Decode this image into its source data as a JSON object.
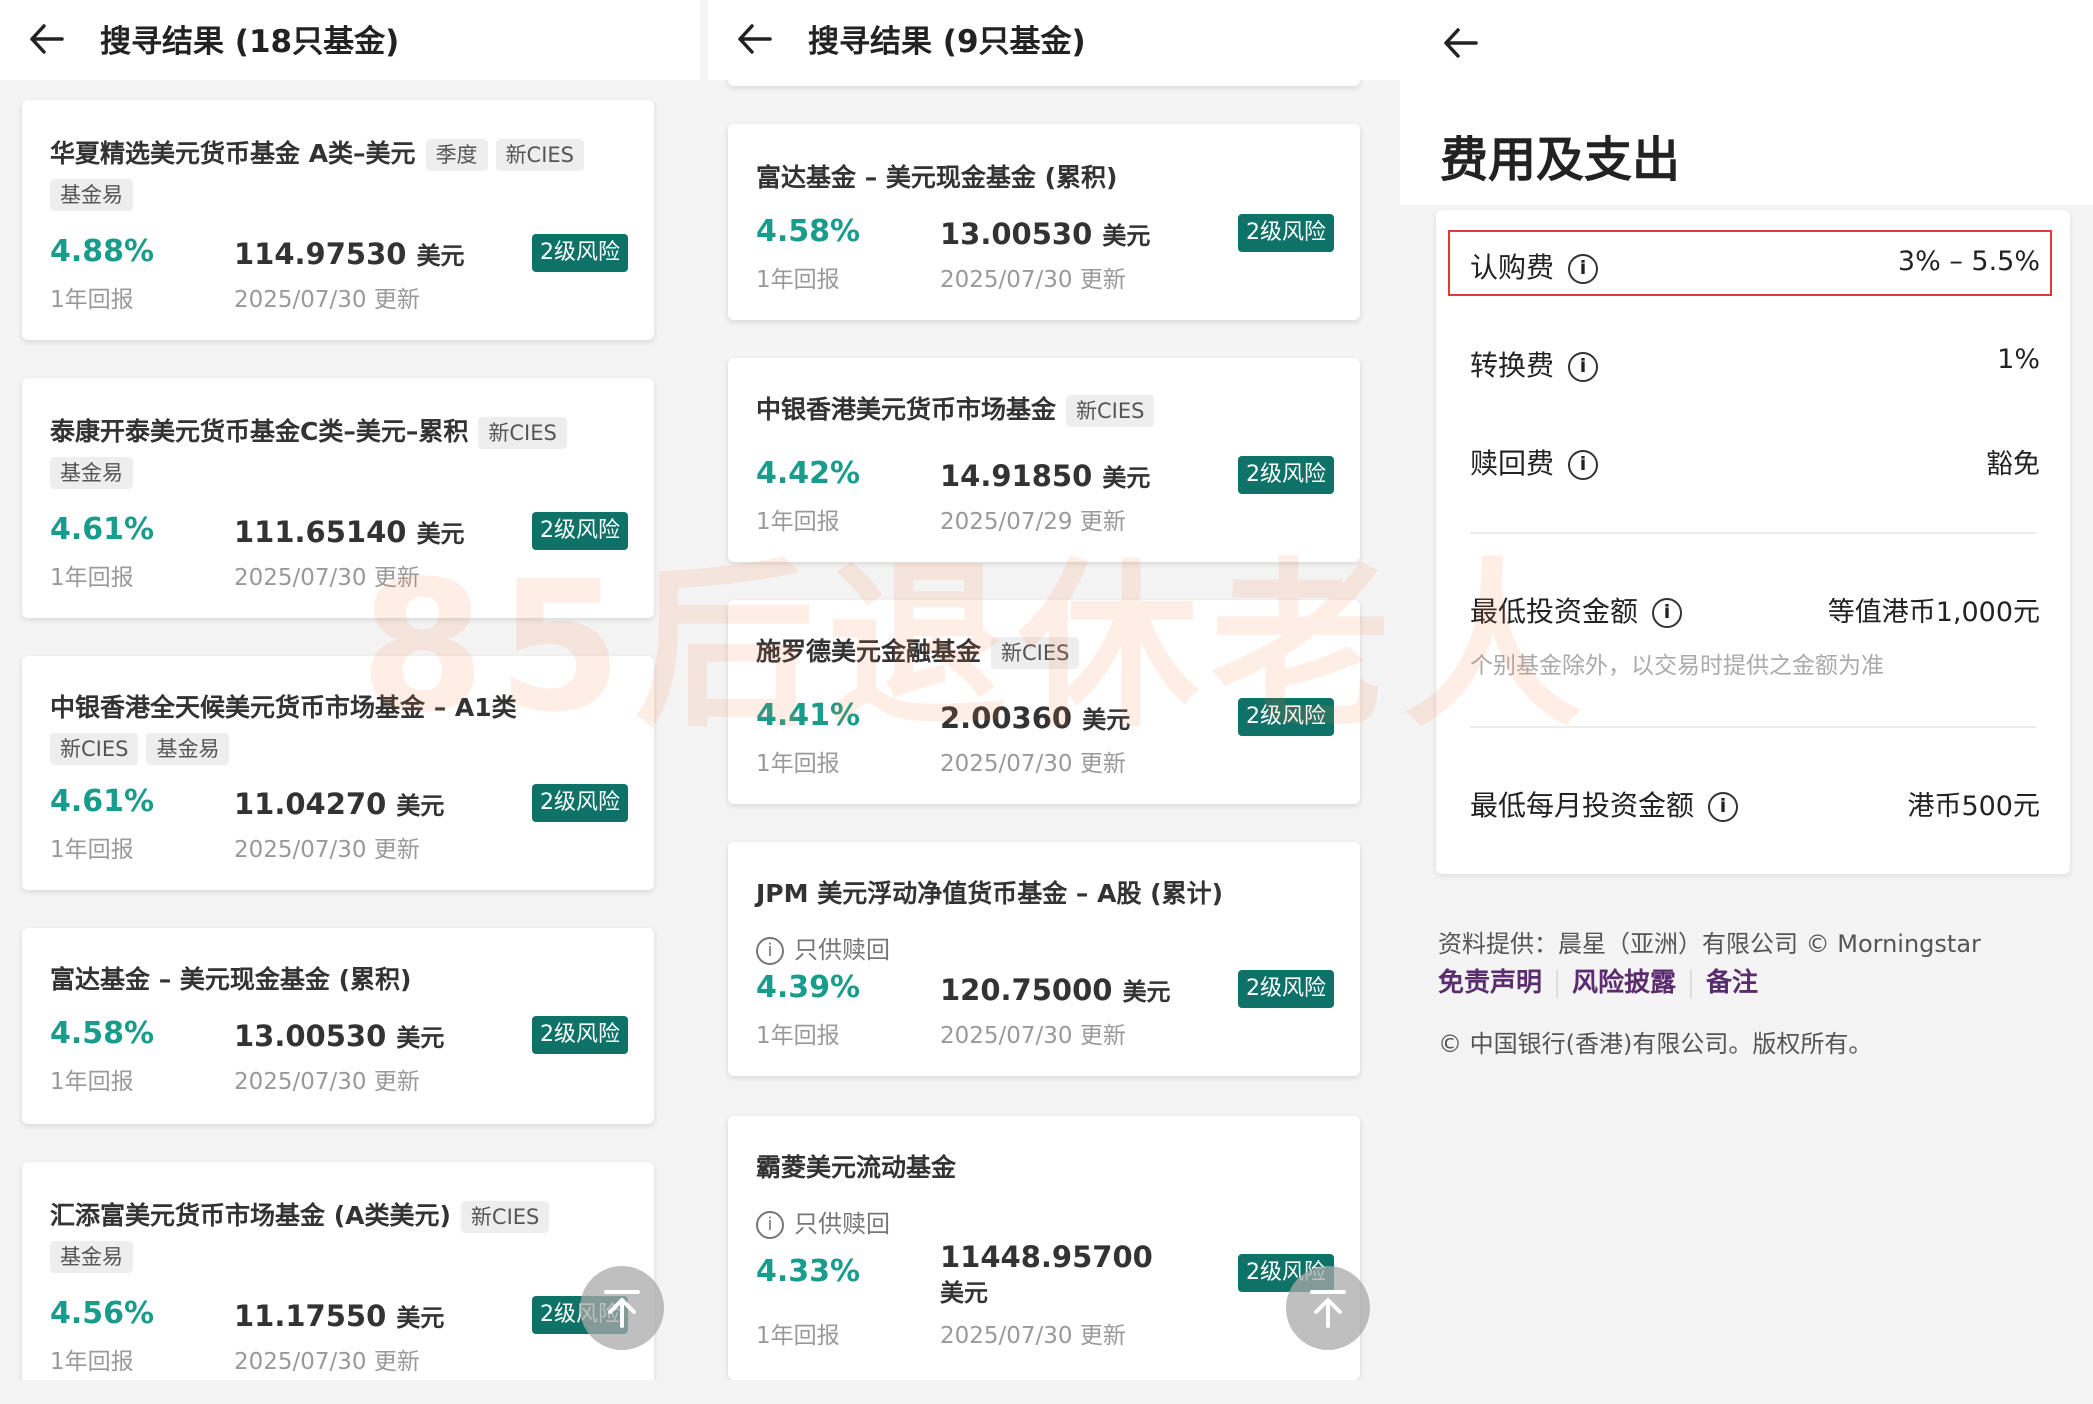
{
  "panel1": {
    "title": "搜寻结果 (18只基金)",
    "cards": [
      {
        "name": "华夏精选美元货币基金 A类–美元",
        "tags_inline": [
          "季度",
          "新CIES"
        ],
        "tags_next": [
          "基金易"
        ],
        "return": "4.88%",
        "return_label": "1年回报",
        "nav": "114.97530",
        "unit": "美元",
        "date": "2025/07/30 更新",
        "risk": "2级风险"
      },
      {
        "name": "泰康开泰美元货币基金C类–美元–累积",
        "tags_inline": [
          "新CIES"
        ],
        "tags_next": [
          "基金易"
        ],
        "return": "4.61%",
        "return_label": "1年回报",
        "nav": "111.65140",
        "unit": "美元",
        "date": "2025/07/30 更新",
        "risk": "2级风险"
      },
      {
        "name": "中银香港全天候美元货币市场基金 – A1类",
        "tags_inline": [],
        "tags_next": [
          "新CIES",
          "基金易"
        ],
        "return": "4.61%",
        "return_label": "1年回报",
        "nav": "11.04270",
        "unit": "美元",
        "date": "2025/07/30 更新",
        "risk": "2级风险"
      },
      {
        "name": "富达基金 – 美元现金基金 (累积)",
        "tags_inline": [],
        "tags_next": [],
        "return": "4.58%",
        "return_label": "1年回报",
        "nav": "13.00530",
        "unit": "美元",
        "date": "2025/07/30 更新",
        "risk": "2级风险"
      },
      {
        "name": "汇添富美元货币市场基金 (A类美元)",
        "tags_inline": [
          "新CIES"
        ],
        "tags_next": [
          "基金易"
        ],
        "return": "4.56%",
        "return_label": "1年回报",
        "nav": "11.17550",
        "unit": "美元",
        "date": "2025/07/30 更新",
        "risk": "2级风险"
      }
    ]
  },
  "panel2": {
    "title": "搜寻结果 (9只基金)",
    "cards": [
      {
        "name": "富达基金 – 美元现金基金 (累积)",
        "tags_inline": [],
        "return": "4.58%",
        "return_label": "1年回报",
        "nav": "13.00530",
        "unit": "美元",
        "date": "2025/07/30 更新",
        "risk": "2级风险"
      },
      {
        "name": "中银香港美元货币市场基金",
        "tags_inline": [
          "新CIES"
        ],
        "return": "4.42%",
        "return_label": "1年回报",
        "nav": "14.91850",
        "unit": "美元",
        "date": "2025/07/29 更新",
        "risk": "2级风险"
      },
      {
        "name": "施罗德美元金融基金",
        "tags_inline": [
          "新CIES"
        ],
        "return": "4.41%",
        "return_label": "1年回报",
        "nav": "2.00360",
        "unit": "美元",
        "date": "2025/07/30 更新",
        "risk": "2级风险"
      },
      {
        "name": "JPM 美元浮动净值货币基金 – A股 (累计)",
        "tags_inline": [],
        "redeem": "只供赎回",
        "return": "4.39%",
        "return_label": "1年回报",
        "nav": "120.75000",
        "unit": "美元",
        "date": "2025/07/30 更新",
        "risk": "2级风险"
      },
      {
        "name": "霸菱美元流动基金",
        "tags_inline": [],
        "redeem": "只供赎回",
        "return": "4.33%",
        "return_label": "1年回报",
        "nav": "11448.95700",
        "unit": "美元",
        "date": "2025/07/30 更新",
        "risk": "2级风险"
      }
    ]
  },
  "panel3": {
    "title": "费用及支出",
    "fees": [
      {
        "label": "认购费",
        "value": "3% – 5.5%"
      },
      {
        "label": "转换费",
        "value": "1%"
      },
      {
        "label": "赎回费",
        "value": "豁免"
      }
    ],
    "min_invest_label": "最低投资金额",
    "min_invest_value": "等值港币1,000元",
    "min_invest_note": "个别基金除外，以交易时提供之金额为准",
    "min_monthly_label": "最低每月投资金额",
    "min_monthly_value": "港币500元",
    "source": "资料提供：晨星（亚洲）有限公司 © Morningstar",
    "links": [
      "免责声明",
      "风险披露",
      "备注"
    ],
    "copyright": "© 中国银行(香港)有限公司。版权所有。"
  },
  "watermark": "85后退休老人",
  "colors": {
    "accent": "#1a9c8c",
    "risk_badge": "#0e7268",
    "highlight": "#e53935",
    "link": "#5b2c6f"
  }
}
